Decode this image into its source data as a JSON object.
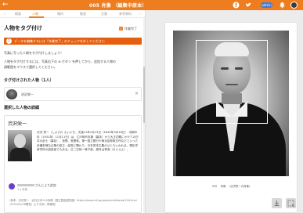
{
  "header": {
    "title": "005 肖像 （編集中原本）",
    "back_glyph": "←",
    "admin_label": "admin",
    "icons": [
      "facebook-icon",
      "twitter-icon",
      "bell-icon"
    ]
  },
  "tabs": [
    {
      "label": "概要",
      "active": false
    },
    {
      "label": "人物",
      "active": true
    },
    {
      "label": "場所",
      "active": false
    },
    {
      "label": "動画",
      "active": false
    },
    {
      "label": "言葉",
      "active": false
    },
    {
      "label": "参考資料",
      "active": false
    }
  ],
  "tag_section": {
    "title": "人物をタグ付け",
    "checkbox_label": "作業完了",
    "banner_text": "データを編集するには「作業完了」のチェックを外してください",
    "intro": "写真に写った人物をタグ付けしましょう！",
    "instruction_line1": "人物をタグ付けするには、写真右下の ⊕ ボタン を押してから、追加する人物の",
    "instruction_line2": "顔範囲をマウスで選択してください。",
    "tagged_heading": "タグ付けされた人物（1人）",
    "tagged_person": "渋沢栄一",
    "close_glyph": "×"
  },
  "detail": {
    "heading": "選択した人物の詳細",
    "name": "渋沢栄一",
    "bio": "渋沢 栄一（しぶさわ えいいち、天保11年2月13日（1840年3月16日）- 昭和6年（1931年）11月11日）は、江戸時代末期（幕末）から大正初期にかけての日本の武士（幕臣）、官僚、実業家。第一国立銀行や東京証券取引所などといった多種多様な企業の設立・経営に関わり、日本資本主義の父ともいわれる。理化学研究所の創設者でもある。正二位勲一等子爵。雅号は青淵（せいえん）。",
    "author_suffix": "さんにより追加",
    "author_date": "1ヶ月前",
    "source": "（参考：渋沢栄一 - 近代日本人の肖像（国立国会図書館）https://www.ndl.go.jp/portrait/datas/104.html（2021/02/18閲覧）より引用・再構成）"
  },
  "viewer": {
    "caption": "005 　肖像 　(渋沢栄一の肖像)",
    "tool_buttons": [
      "download-icon",
      "add-tag-icon"
    ]
  },
  "colors": {
    "brand_orange": "#ee7d1f",
    "banner_orange": "#e55f0e",
    "admin_blue": "#3f7bd9"
  }
}
